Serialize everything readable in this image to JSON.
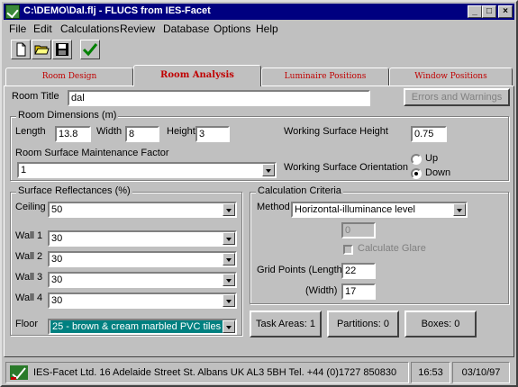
{
  "window": {
    "title": "C:\\DEMO\\Dal.flj - FLUCS from IES-Facet",
    "min_symbol": "_",
    "max_symbol": "□",
    "close_symbol": "×"
  },
  "menu": [
    "File",
    "Edit",
    "Calculations",
    "Review",
    "Database",
    "Options",
    "Help"
  ],
  "toolbar": {
    "icons": [
      "new-document-icon",
      "open-folder-icon",
      "save-disk-icon",
      "checkmark-icon"
    ]
  },
  "tabs": [
    {
      "label": "Room Design",
      "active": false
    },
    {
      "label": "Room Analysis",
      "active": true
    },
    {
      "label": "Luminaire Positions",
      "active": false
    },
    {
      "label": "Window Positions",
      "active": false
    }
  ],
  "room": {
    "title_label": "Room Title",
    "title_value": "dal",
    "errors_button": "Errors and Warnings"
  },
  "dimensions": {
    "group_label": "Room Dimensions (m)",
    "length_label": "Length",
    "length_value": "13.8",
    "width_label": "Width",
    "width_value": "8",
    "height_label": "Height",
    "height_value": "3",
    "maintenance_label": "Room Surface Maintenance Factor",
    "maintenance_value": "1",
    "wsh_label": "Working Surface Height",
    "wsh_value": "0.75",
    "orientation_label": "Working Surface Orientation",
    "up_label": "Up",
    "down_label": "Down",
    "orientation_selected": "Down"
  },
  "reflectances": {
    "group_label": "Surface Reflectances (%)",
    "ceiling_label": "Ceiling",
    "ceiling_value": "50",
    "wall1_label": "Wall 1",
    "wall1_value": "30",
    "wall2_label": "Wall 2",
    "wall2_value": "30",
    "wall3_label": "Wall 3",
    "wall3_value": "30",
    "wall4_label": "Wall 4",
    "wall4_value": "30",
    "floor_label": "Floor",
    "floor_value": "25 - brown & cream marbled PVC tiles"
  },
  "criteria": {
    "group_label": "Calculation Criteria",
    "method_label": "Method",
    "method_value": "Horizontal-illuminance level",
    "disabled_value": "0",
    "glare_label": "Calculate Glare",
    "grid_length_label": "Grid Points (Length)",
    "grid_length_value": "22",
    "grid_width_label": "(Width)",
    "grid_width_value": "17"
  },
  "bottom_buttons": {
    "task_areas": "Task Areas: 1",
    "partitions": "Partitions: 0",
    "boxes": "Boxes: 0"
  },
  "statusbar": {
    "company": "IES-Facet Ltd. 16 Adelaide Street St. Albans UK AL3 5BH Tel. +44 (0)1727 850830",
    "time": "16:53",
    "date": "03/10/97"
  },
  "colors": {
    "titlebar": "#000080",
    "tab_text": "#c00000",
    "selection": "#008080"
  }
}
